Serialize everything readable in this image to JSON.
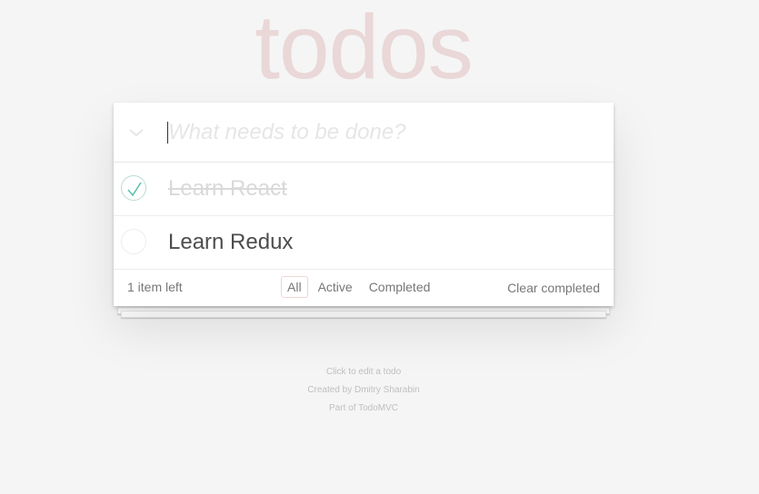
{
  "app": {
    "title": "todos"
  },
  "header": {
    "new_todo_placeholder": "What needs to be done?",
    "toggle_all_icon": "chevron-down-icon"
  },
  "todos": [
    {
      "label": "Learn React",
      "completed": true
    },
    {
      "label": "Learn Redux",
      "completed": false
    }
  ],
  "footer": {
    "count_number": "1",
    "count_suffix": " item left",
    "filters": [
      {
        "label": "All",
        "selected": true
      },
      {
        "label": "Active",
        "selected": false
      },
      {
        "label": "Completed",
        "selected": false
      }
    ],
    "clear_completed_label": "Clear completed"
  },
  "info": {
    "edit_hint": "Click to edit a todo",
    "created_by_prefix": "Created by ",
    "author": "Dmitry Sharabin",
    "part_of_prefix": "Part of ",
    "todomvc": "TodoMVC"
  },
  "colors": {
    "title": "#efd5d5",
    "check": "#5dc2af",
    "selected_filter_border": "#e9cccc",
    "background": "#f5f5f5"
  }
}
